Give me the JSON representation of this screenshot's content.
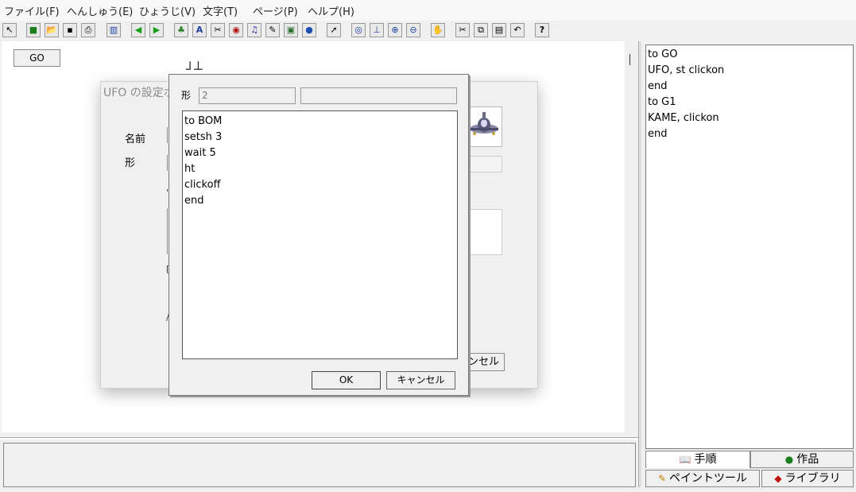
{
  "menu": [
    {
      "label": "ファイル(F)"
    },
    {
      "label": "へんしゅう(E)"
    },
    {
      "label": "ひょうじ(V)"
    },
    {
      "label": "文字(T)"
    },
    {
      "label": "ページ(P)"
    },
    {
      "label": "ヘルプ(H)"
    }
  ],
  "toolbar": [
    {
      "icon": "pointer-icon",
      "glyph": "↖"
    },
    {
      "icon": "new-icon",
      "glyph": "■"
    },
    {
      "icon": "open-folder-icon",
      "glyph": "📂"
    },
    {
      "icon": "save-icon",
      "glyph": "▪"
    },
    {
      "icon": "print-icon",
      "glyph": "⎙"
    },
    {
      "icon": "book-icon",
      "glyph": "▥"
    },
    {
      "icon": "back-arrow-icon",
      "glyph": "◀"
    },
    {
      "icon": "forward-arrow-icon",
      "glyph": "▶"
    },
    {
      "icon": "character-icon",
      "glyph": "♣"
    },
    {
      "icon": "text-icon",
      "glyph": "A"
    },
    {
      "icon": "tool-icon",
      "glyph": "✂"
    },
    {
      "icon": "eye-red-icon",
      "glyph": "◉"
    },
    {
      "icon": "music-icon",
      "glyph": "♫"
    },
    {
      "icon": "pen-icon",
      "glyph": "✎"
    },
    {
      "icon": "video-icon",
      "glyph": "▣"
    },
    {
      "icon": "globe-icon",
      "glyph": "●"
    },
    {
      "icon": "arrow-cursor-icon",
      "glyph": "➚"
    },
    {
      "icon": "eye-icon",
      "glyph": "◎"
    },
    {
      "icon": "stamp-icon",
      "glyph": "⊥"
    },
    {
      "icon": "zoom-in-icon",
      "glyph": "⊕"
    },
    {
      "icon": "zoom-out-icon",
      "glyph": "⊖"
    },
    {
      "icon": "stop-hand-icon",
      "glyph": "✋"
    },
    {
      "icon": "cut-icon",
      "glyph": "✂"
    },
    {
      "icon": "copy-icon",
      "glyph": "⧉"
    },
    {
      "icon": "paste-icon",
      "glyph": "▤"
    },
    {
      "icon": "undo-icon",
      "glyph": "↶"
    },
    {
      "icon": "help-icon",
      "glyph": "?"
    }
  ],
  "canvas": {
    "go_button": "GO"
  },
  "code_panel": {
    "lines": [
      "to GO",
      "UFO, st clickon",
      "end",
      "to G1",
      "KAME, clickon",
      "end"
    ]
  },
  "right_tabs": {
    "procedure": "手順",
    "work": "作品",
    "paint_tool": "ペイントツール",
    "library": "ライブラリ"
  },
  "bg_dialog": {
    "title": "UFO の設定ボ",
    "name_label": "名前",
    "shape_label": "形",
    "cancel_fragment": "ンセル"
  },
  "fg_dialog": {
    "shape_label": "形",
    "shape_value": "2",
    "code_lines": [
      "to BOM",
      "setsh 3",
      "wait 5",
      "ht",
      "clickoff",
      "end"
    ],
    "ok_label": "OK",
    "cancel_label": "キャンセル"
  }
}
